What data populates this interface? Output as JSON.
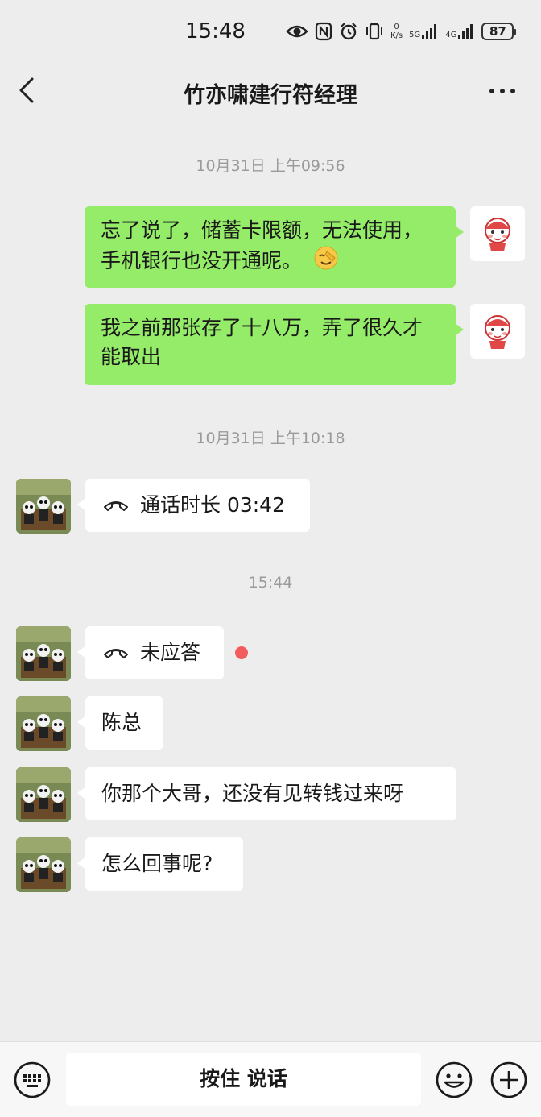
{
  "status_bar": {
    "time": "15:48",
    "net_speed_value": "0",
    "net_speed_unit": "K/s",
    "sim1_label": "5G",
    "sim2_label": "4G",
    "battery": "87"
  },
  "header": {
    "title": "竹亦啸建行符经理"
  },
  "messages": {
    "ts1": "10月31日 上午09:56",
    "m1_text": "忘了说了，储蓄卡限额，无法使用，手机银行也没开通呢。",
    "m2_text": "我之前那张存了十八万，弄了很久才能取出",
    "ts2": "10月31日 上午10:18",
    "call1_text": "通话时长 03:42",
    "ts3": "15:44",
    "call2_text": "未应答",
    "m3_text": "陈总",
    "m4_text": "你那个大哥，还没有见转钱过来呀",
    "m5_text": "怎么回事呢?"
  },
  "input_bar": {
    "voice_label": "按住 说话"
  },
  "colors": {
    "self_bubble": "#95ec69",
    "other_bubble": "#ffffff",
    "background": "#ededed",
    "unread_dot": "#f25c5c"
  },
  "icons": [
    "eye-icon",
    "nfc-icon",
    "alarm-icon",
    "vibrate-icon",
    "signal-icon",
    "back-arrow-icon",
    "more-icon",
    "phone-hangup-icon",
    "facepalm-emoji-icon",
    "keyboard-icon",
    "emoji-icon",
    "plus-icon"
  ]
}
